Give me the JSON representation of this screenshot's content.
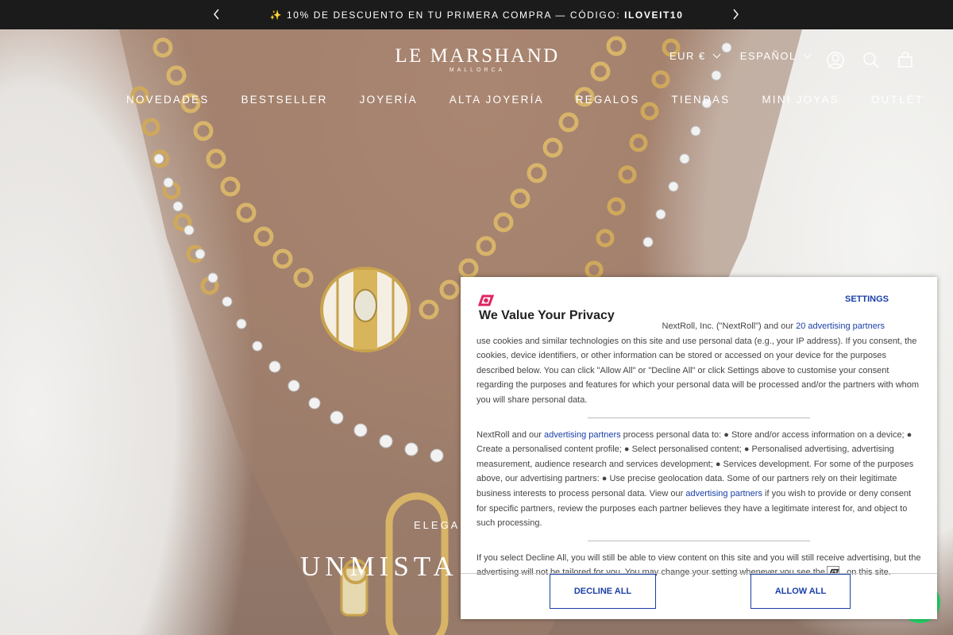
{
  "announcement": {
    "text_prefix": "✨ 10% DE DESCUENTO EN TU PRIMERA COMPRA — CÓDIGO: ",
    "code": "ILOVEIT10",
    "prev_icon": "chevron-left-icon",
    "next_icon": "chevron-right-icon"
  },
  "header": {
    "logo_name": "LE MARSHAND",
    "logo_sub": "MALLORCA",
    "currency": "EUR €",
    "language": "ESPAÑOL",
    "icons": [
      "account-icon",
      "search-icon",
      "cart-icon"
    ],
    "nav": [
      "NOVEDADES",
      "BESTSELLER",
      "JOYERÍA",
      "ALTA JOYERÍA",
      "REGALOS",
      "TIENDAS",
      "MINI JOYAS",
      "OUTLET"
    ]
  },
  "hero": {
    "eyebrow": "ELEGAN",
    "headline": "UNMISTA"
  },
  "privacy": {
    "title": "We Value Your Privacy",
    "settings_label": "SETTINGS",
    "p1_a": "NextRoll, Inc. (\"NextRoll\") and our ",
    "p1_link": "20 advertising partners",
    "p1_b": " use cookies and similar technologies on this site and use personal data (e.g., your IP address). If you consent, the cookies, device identifiers, or other information can be stored or accessed on your device for the purposes described below. You can click \"Allow All\" or \"Decline All\" or click Settings above to customise your consent regarding the purposes and features for which your personal data will be processed and/or the partners with whom you will share personal data.",
    "p2_a": "NextRoll and our ",
    "p2_link1": "advertising partners",
    "p2_b": " process personal data to: ● Store and/or access information on a device; ● Create a personalised content profile; ● Select personalised content; ● Personalised advertising, advertising measurement, audience research and services development; ● Services development. For some of the purposes above, our advertising partners: ● Use precise geolocation data. Some of our partners rely on their legitimate business interests to process personal data. View our ",
    "p2_link2": "advertising partners",
    "p2_c": " if you wish to provide or deny consent for specific partners, review the purposes each partner believes they have a legitimate interest for, and object to such processing.",
    "p3_a": "If you select Decline All, you will still be able to view content on this site and you will still receive advertising, but the advertising will not be tailored for you. You may change your setting whenever you see the",
    "p3_b": " on this site.",
    "decline_label": "DECLINE ALL",
    "allow_label": "ALLOW ALL",
    "brand_color": "#e0245e",
    "link_color": "#1a3fa8"
  }
}
